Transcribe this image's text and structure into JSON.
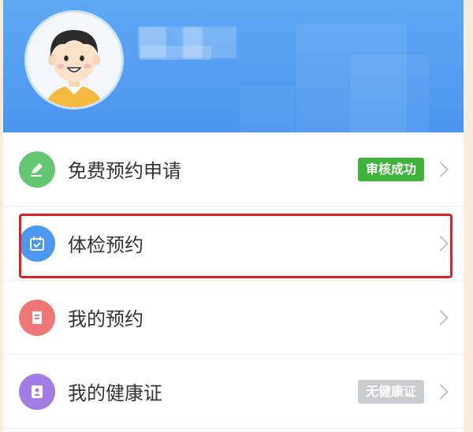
{
  "menu": {
    "items": [
      {
        "label": "免费预约申请",
        "badge": "审核成功",
        "icon": "pencil-icon",
        "icon_color": "#63c771",
        "badge_color": "#3fb33b"
      },
      {
        "label": "体检预约",
        "icon": "calendar-icon",
        "icon_color": "#4c97ef"
      },
      {
        "label": "我的预约",
        "icon": "document-icon",
        "icon_color": "#ef7777"
      },
      {
        "label": "我的健康证",
        "badge": "无健康证",
        "icon": "id-card-icon",
        "icon_color": "#a27de6",
        "badge_color": "#c9cccf"
      }
    ]
  },
  "colors": {
    "header": "#4b95ef",
    "highlight": "#e02020"
  }
}
